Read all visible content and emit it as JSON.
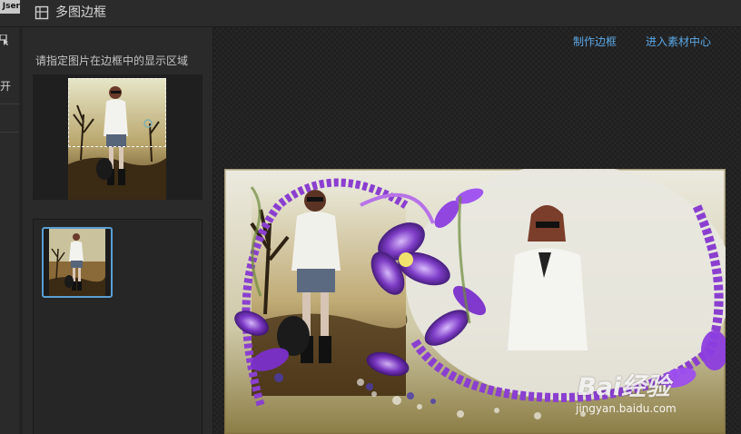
{
  "window": {
    "title": "多图边框",
    "background_tab_label": "Jser"
  },
  "background_app": {
    "open_label": "开"
  },
  "left_panel": {
    "instruction": "请指定图片在边框中的显示区域"
  },
  "header_links": {
    "make_frame": "制作边框",
    "material_center": "进入素材中心"
  },
  "canvas": {
    "watermark_brand": "Bai经验",
    "watermark_url": "jingyan.baidu.com"
  },
  "colors": {
    "link": "#5aa7e6",
    "selected_border": "#5a9fd4",
    "frame_purple": "#8a3fd0",
    "panel_bg": "#2a2a2a"
  },
  "icons": {
    "title": "frame-grid-icon",
    "open": "open-cursor-icon"
  }
}
